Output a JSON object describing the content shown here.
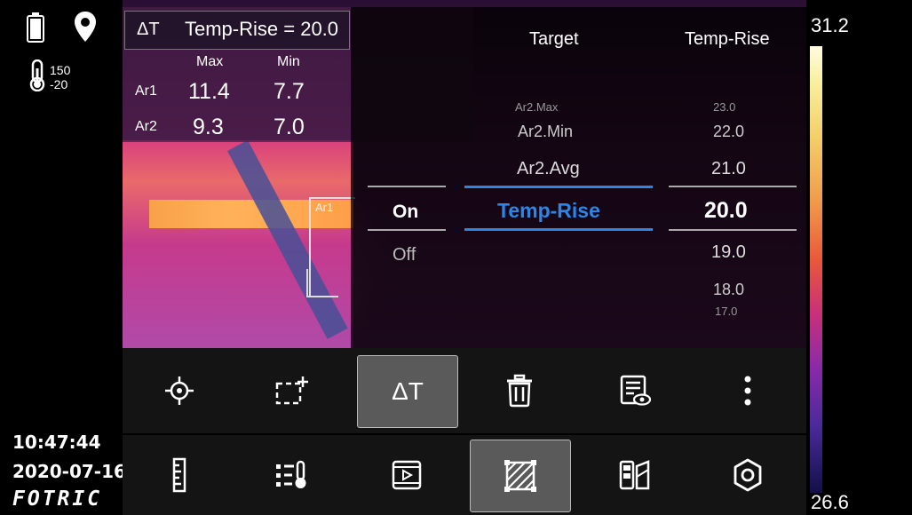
{
  "status": {
    "range_high": "150",
    "range_low": "-20",
    "time": "10:47:44",
    "date": "2020-07-16",
    "brand": "FOTRIC",
    "icons": [
      "battery-icon",
      "location-pin-icon",
      "thermometer-range-icon"
    ]
  },
  "info_panel": {
    "header": "Temp-Rise = 20.0",
    "header_symbol": "ΔT",
    "col_max": "Max",
    "col_min": "Min",
    "rows": [
      {
        "name": "Ar1",
        "max": "11.4",
        "min": "7.7"
      },
      {
        "name": "Ar2",
        "max": "9.3",
        "min": "7.0"
      }
    ]
  },
  "thermal": {
    "area_label": "Ar1"
  },
  "picker": {
    "col_target_title": "Target",
    "col_value_title": "Temp-Rise",
    "toggle": {
      "selected": "On",
      "other": "Off"
    },
    "targets": [
      "Ar2.Max",
      "Ar2.Min",
      "Ar2.Avg",
      "Temp-Rise"
    ],
    "selected_target": "Temp-Rise",
    "values": [
      "23.0",
      "22.0",
      "21.0",
      "20.0",
      "19.0",
      "18.0",
      "17.0"
    ],
    "selected_value": "20.0"
  },
  "colorbar": {
    "max": "31.2",
    "min": "26.6"
  },
  "toolbar_top": {
    "buttons": [
      "crosshair-icon",
      "add-area-icon",
      "delta-t-icon",
      "trash-icon",
      "report-view-icon",
      "more-vertical-icon"
    ],
    "selected": "delta-t-icon",
    "delta_label": "ΔT"
  },
  "toolbar_bottom": {
    "buttons": [
      "ruler-icon",
      "thermometer-list-icon",
      "video-icon",
      "image-hatch-icon",
      "palette-icon",
      "settings-icon"
    ],
    "selected": "image-hatch-icon"
  },
  "colors": {
    "accent_blue": "#2a86e8",
    "selected_bg": "#5a5a5a"
  }
}
